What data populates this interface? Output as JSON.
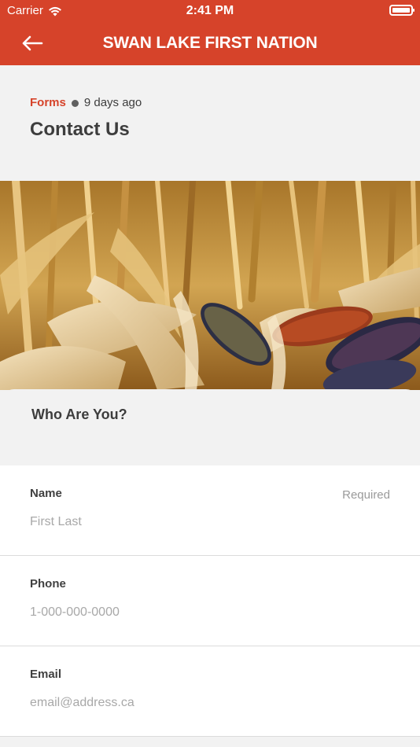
{
  "status_bar": {
    "carrier": "Carrier",
    "time": "2:41 PM"
  },
  "nav": {
    "title": "SWAN LAKE FIRST NATION",
    "back_icon": "arrow-left-icon"
  },
  "post": {
    "category": "Forms",
    "posted": "9 days ago",
    "title": "Contact Us"
  },
  "form": {
    "section_title": "Who Are You?",
    "fields": [
      {
        "label": "Name",
        "required_label": "Required",
        "placeholder": "First Last"
      },
      {
        "label": "Phone",
        "required_label": "",
        "placeholder": "1-000-000-0000"
      },
      {
        "label": "Email",
        "required_label": "",
        "placeholder": "email@address.ca"
      }
    ]
  },
  "colors": {
    "accent": "#d6432a",
    "text_dark": "#3d3d3d",
    "placeholder": "#a8a8a8",
    "background": "#f2f2f2"
  }
}
